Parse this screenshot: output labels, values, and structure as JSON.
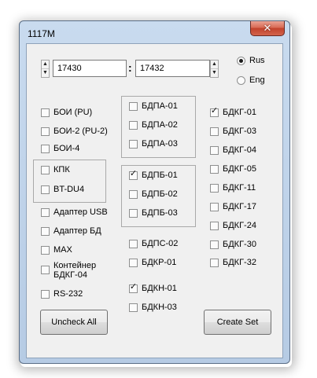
{
  "window": {
    "title": "1117M",
    "close_glyph": "✕"
  },
  "range": {
    "from_value": "17430",
    "to_value": "17432",
    "separator": ":"
  },
  "language": {
    "options": [
      {
        "label": "Rus",
        "selected": true
      },
      {
        "label": "Eng",
        "selected": false
      }
    ]
  },
  "checkboxes": {
    "boi_pu": {
      "label": "БОИ (PU)",
      "checked": false
    },
    "boi2_pu2": {
      "label": "БОИ-2 (PU-2)",
      "checked": false
    },
    "boi4": {
      "label": "БОИ-4",
      "checked": false
    },
    "kpk": {
      "label": "КПК",
      "checked": false
    },
    "bt_du4": {
      "label": "BT-DU4",
      "checked": false
    },
    "adapter_usb": {
      "label": "Адаптер USB",
      "checked": false
    },
    "adapter_bd": {
      "label": "Адаптер БД",
      "checked": false
    },
    "max": {
      "label": "MAX",
      "checked": false
    },
    "container_l1": {
      "label": "Контейнер",
      "checked": false
    },
    "container_l2": {
      "label": "БДКГ-04"
    },
    "rs232": {
      "label": "RS-232",
      "checked": false
    },
    "bdpa01": {
      "label": "БДПА-01",
      "checked": false
    },
    "bdpa02": {
      "label": "БДПА-02",
      "checked": false
    },
    "bdpa03": {
      "label": "БДПА-03",
      "checked": false
    },
    "bdpb01": {
      "label": "БДПБ-01",
      "checked": true
    },
    "bdpb02": {
      "label": "БДПБ-02",
      "checked": false
    },
    "bdpb03": {
      "label": "БДПБ-03",
      "checked": false
    },
    "bdps02": {
      "label": "БДПС-02",
      "checked": false
    },
    "bdkr01": {
      "label": "БДКР-01",
      "checked": false
    },
    "bdkn01": {
      "label": "БДКН-01",
      "checked": true
    },
    "bdkn03": {
      "label": "БДКН-03",
      "checked": false
    },
    "bdkg01": {
      "label": "БДКГ-01",
      "checked": true
    },
    "bdkg03": {
      "label": "БДКГ-03",
      "checked": false
    },
    "bdkg04": {
      "label": "БДКГ-04",
      "checked": false
    },
    "bdkg05": {
      "label": "БДКГ-05",
      "checked": false
    },
    "bdkg11": {
      "label": "БДКГ-11",
      "checked": false
    },
    "bdkg17": {
      "label": "БДКГ-17",
      "checked": false
    },
    "bdkg24": {
      "label": "БДКГ-24",
      "checked": false
    },
    "bdkg30": {
      "label": "БДКГ-30",
      "checked": false
    },
    "bdkg32": {
      "label": "БДКГ-32",
      "checked": false
    }
  },
  "buttons": {
    "uncheck_all": "Uncheck All",
    "create_set": "Create Set"
  },
  "glyphs": {
    "check": "✓",
    "spin_up": "▲",
    "spin_down": "▼"
  }
}
